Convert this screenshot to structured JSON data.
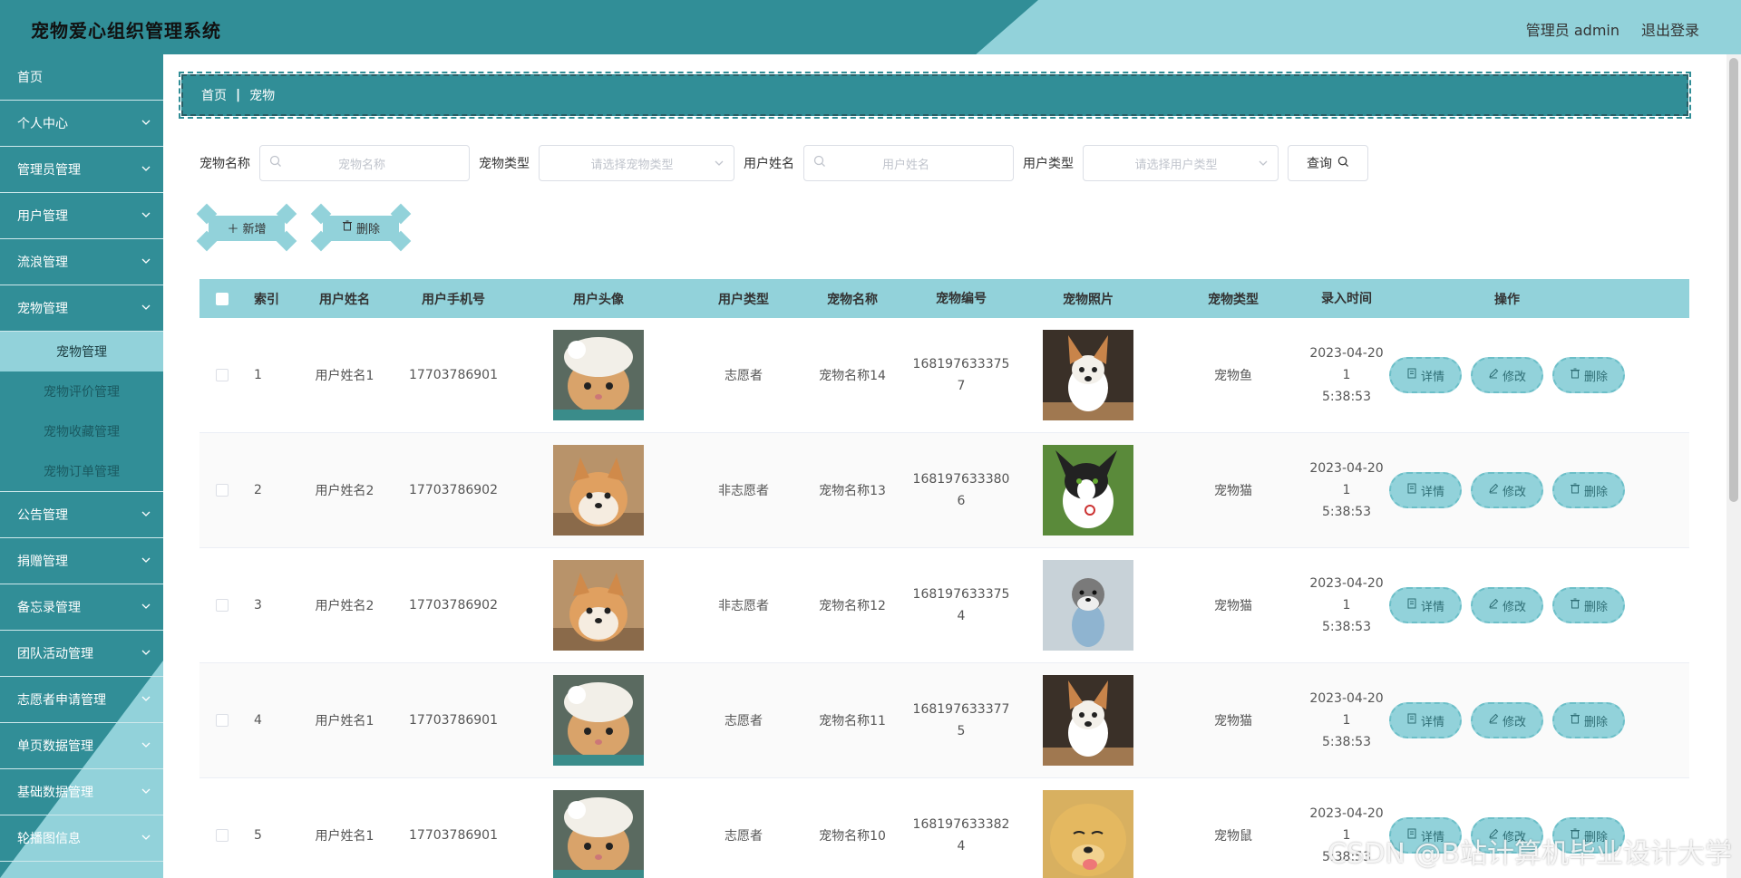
{
  "header": {
    "title": "宠物爱心组织管理系统",
    "admin": "管理员 admin",
    "logout": "退出登录"
  },
  "sidebar": {
    "items": [
      {
        "label": "首页",
        "expandable": false
      },
      {
        "label": "个人中心",
        "expandable": true
      },
      {
        "label": "管理员管理",
        "expandable": true
      },
      {
        "label": "用户管理",
        "expandable": true
      },
      {
        "label": "流浪管理",
        "expandable": true
      },
      {
        "label": "宠物管理",
        "expandable": true,
        "expanded": true,
        "children": [
          "宠物管理",
          "宠物评价管理",
          "宠物收藏管理",
          "宠物订单管理"
        ]
      },
      {
        "label": "公告管理",
        "expandable": true
      },
      {
        "label": "捐赠管理",
        "expandable": true
      },
      {
        "label": "备忘录管理",
        "expandable": true
      },
      {
        "label": "团队活动管理",
        "expandable": true
      },
      {
        "label": "志愿者申请管理",
        "expandable": true
      },
      {
        "label": "单页数据管理",
        "expandable": true
      },
      {
        "label": "基础数据管理",
        "expandable": true
      },
      {
        "label": "轮播图信息",
        "expandable": true
      }
    ]
  },
  "breadcrumb": {
    "home": "首页",
    "sep": "|",
    "current": "宠物"
  },
  "search": {
    "pet_name_label": "宠物名称",
    "pet_name_placeholder": "宠物名称",
    "pet_type_label": "宠物类型",
    "pet_type_placeholder": "请选择宠物类型",
    "user_name_label": "用户姓名",
    "user_name_placeholder": "用户姓名",
    "user_type_label": "用户类型",
    "user_type_placeholder": "请选择用户类型",
    "query_label": "查询"
  },
  "actions": {
    "add_label": "新增",
    "delete_label": "删除"
  },
  "table": {
    "headers": [
      "索引",
      "用户姓名",
      "用户手机号",
      "用户头像",
      "用户类型",
      "宠物名称",
      "宠物编号",
      "宠物照片",
      "宠物类型",
      "录入时间",
      "操作"
    ],
    "rows": [
      {
        "index": "1",
        "user_name": "用户姓名1",
        "phone": "17703786901",
        "avatar": "cat",
        "user_type": "志愿者",
        "pet_name": "宠物名称14",
        "pet_no_1": "168197633375",
        "pet_no_2": "7",
        "photo": "corgi",
        "pet_type": "宠物鱼",
        "time_1": "2023-04-20 1",
        "time_2": "5:38:53"
      },
      {
        "index": "2",
        "user_name": "用户姓名2",
        "phone": "17703786902",
        "avatar": "shiba",
        "user_type": "非志愿者",
        "pet_name": "宠物名称13",
        "pet_no_1": "168197633380",
        "pet_no_2": "6",
        "photo": "chihuahua",
        "pet_type": "宠物猫",
        "time_1": "2023-04-20 1",
        "time_2": "5:38:53"
      },
      {
        "index": "3",
        "user_name": "用户姓名2",
        "phone": "17703786902",
        "avatar": "shiba",
        "user_type": "非志愿者",
        "pet_name": "宠物名称12",
        "pet_no_1": "168197633375",
        "pet_no_2": "4",
        "photo": "schnauzer",
        "pet_type": "宠物猫",
        "time_1": "2023-04-20 1",
        "time_2": "5:38:53"
      },
      {
        "index": "4",
        "user_name": "用户姓名1",
        "phone": "17703786901",
        "avatar": "cat",
        "user_type": "志愿者",
        "pet_name": "宠物名称11",
        "pet_no_1": "168197633377",
        "pet_no_2": "5",
        "photo": "corgi",
        "pet_type": "宠物猫",
        "time_1": "2023-04-20 1",
        "time_2": "5:38:53"
      },
      {
        "index": "5",
        "user_name": "用户姓名1",
        "phone": "17703786901",
        "avatar": "cat",
        "user_type": "志愿者",
        "pet_name": "宠物名称10",
        "pet_no_1": "168197633382",
        "pet_no_2": "4",
        "photo": "golden",
        "pet_type": "宠物鼠",
        "time_1": "2023-04-20 1",
        "time_2": "5:38:53"
      }
    ],
    "ops": {
      "detail": "详情",
      "edit": "修改",
      "delete": "删除"
    }
  },
  "watermark": "CSDN @B站计算机毕业设计大学",
  "colors": {
    "primary": "#318e97",
    "light": "#92d2da"
  }
}
